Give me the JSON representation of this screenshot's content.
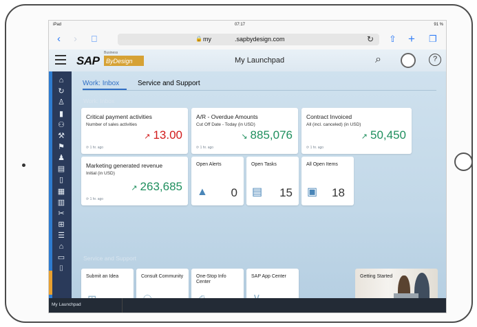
{
  "status": {
    "left": "iPad",
    "time": "07:17",
    "battery": "91 %"
  },
  "safari": {
    "back_icon": "chevron-left-icon",
    "forward_icon": "chevron-right-icon",
    "bookmarks_icon": "book-icon",
    "url_prefix": "my",
    "url_domain": ".sapbydesign.com",
    "reload_icon": "reload-icon",
    "share_icon": "share-icon",
    "add_icon": "plus-icon",
    "tabs_icon": "tabs-icon"
  },
  "shell": {
    "logo_sap": "SAP",
    "logo_business": "Business",
    "logo_bydesign": "ByDesign",
    "title": "My Launchpad"
  },
  "tabs": [
    {
      "label": "Work: Inbox"
    },
    {
      "label": "Service and Support"
    }
  ],
  "groups": {
    "work": "Work: Inbox",
    "service": "Service and Support"
  },
  "kpi_tiles": [
    {
      "title": "Critical payment activities",
      "subtitle": "Number of sales activities",
      "value": "13.00",
      "arrow": "↗",
      "color": "#d11a1a",
      "footer": "1 hr. ago"
    },
    {
      "title": "A/R - Overdue Amounts",
      "subtitle": "Cut Off Date - Today (in USD)",
      "value": "885,076",
      "arrow": "↘",
      "color": "#1f8f5e",
      "footer": "1 hr. ago"
    },
    {
      "title": "Contract Invoiced",
      "subtitle": "All (incl. canceled) (in USD)",
      "value": "50,450",
      "arrow": "↗",
      "color": "#1f8f5e",
      "footer": "1 hr. ago"
    },
    {
      "title": "Marketing generated revenue",
      "subtitle": "Initial (in USD)",
      "value": "263,685",
      "arrow": "↗",
      "color": "#1f8f5e",
      "footer": "1 hr. ago"
    }
  ],
  "count_tiles": [
    {
      "title": "Open Alerts",
      "count": "0",
      "icon": "warning-icon"
    },
    {
      "title": "Open Tasks",
      "count": "15",
      "icon": "clipboard-icon"
    },
    {
      "title": "All Open Items",
      "count": "18",
      "icon": "document-icon"
    }
  ],
  "service_tiles": [
    {
      "title": "Submit an Idea",
      "icon": "idea-icon"
    },
    {
      "title": "Consult Community",
      "icon": "community-icon"
    },
    {
      "title": "One-Stop Info Center",
      "icon": "info-center-icon"
    },
    {
      "title": "SAP App Center",
      "icon": "cart-icon"
    },
    {
      "title": "Getting Started",
      "icon": "photo-people"
    }
  ],
  "bottom_label": "My Launchpad"
}
